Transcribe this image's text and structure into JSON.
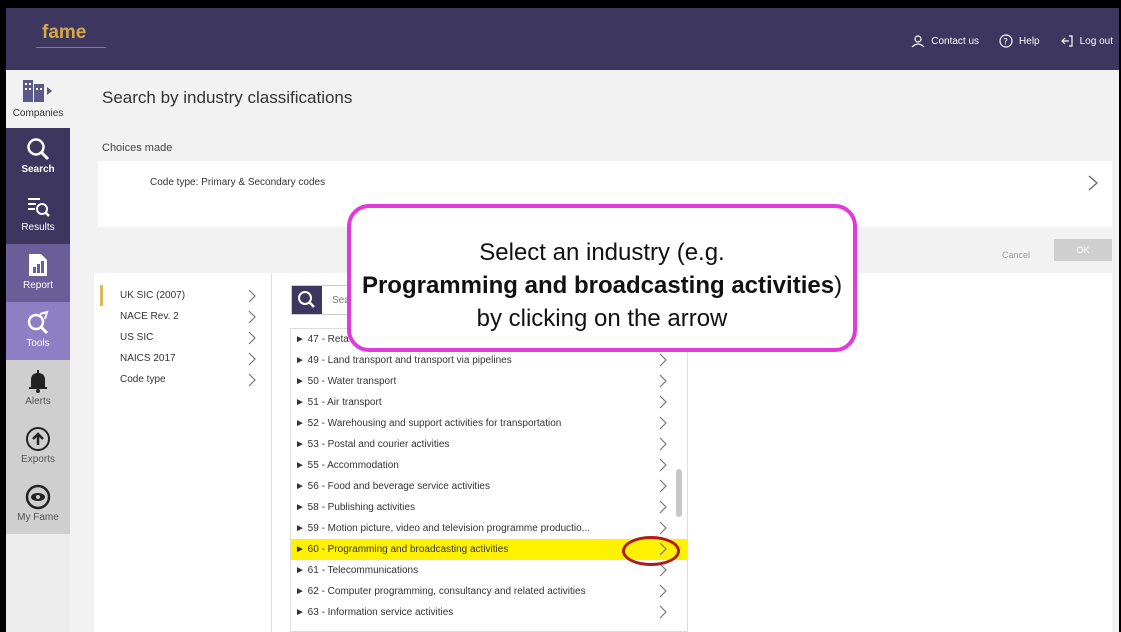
{
  "app": {
    "logo": "fame"
  },
  "topbar": {
    "contact": "Contact us",
    "help": "Help",
    "logout": "Log out"
  },
  "nav": {
    "companies": "Companies",
    "search": "Search",
    "results": "Results",
    "report": "Report",
    "tools": "Tools",
    "alerts": "Alerts",
    "exports": "Exports",
    "myfame": "My Fame"
  },
  "page": {
    "title": "Search by industry classifications",
    "choices_label": "Choices made",
    "code_type": "Code type: Primary & Secondary codes",
    "cancel": "Cancel",
    "ok": "OK"
  },
  "classifications": [
    {
      "label": "UK SIC (2007)",
      "active": true
    },
    {
      "label": "NACE Rev. 2",
      "active": false
    },
    {
      "label": "US SIC",
      "active": false
    },
    {
      "label": "NAICS 2017",
      "active": false
    },
    {
      "label": "Code type",
      "active": false
    }
  ],
  "search": {
    "placeholder": "Sea"
  },
  "industries": [
    {
      "label": "► 47 - Reta",
      "highlight": false
    },
    {
      "label": "► 49 - Land transport and transport via pipelines",
      "highlight": false
    },
    {
      "label": "► 50 - Water transport",
      "highlight": false
    },
    {
      "label": "► 51 - Air transport",
      "highlight": false
    },
    {
      "label": "► 52 - Warehousing and support activities for transportation",
      "highlight": false
    },
    {
      "label": "► 53 - Postal and courier activities",
      "highlight": false
    },
    {
      "label": "► 55 - Accommodation",
      "highlight": false
    },
    {
      "label": "► 56 - Food and beverage service activities",
      "highlight": false
    },
    {
      "label": "► 58 - Publishing activities",
      "highlight": false
    },
    {
      "label": "► 59 - Motion picture, video and television programme productio...",
      "highlight": false
    },
    {
      "label": "► 60 - Programming and broadcasting activities",
      "highlight": true
    },
    {
      "label": "► 61 - Telecommunications",
      "highlight": false
    },
    {
      "label": "► 62 - Computer programming, consultancy and related activities",
      "highlight": false
    },
    {
      "label": "► 63 - Information service activities",
      "highlight": false
    }
  ],
  "callout": {
    "line1": "Select an industry (e.g.",
    "bold": "Programming and broadcasting activities",
    "line3": ") by clicking on the arrow"
  },
  "colors": {
    "brand": "#3d3760",
    "logo": "#d8a64a",
    "highlight": "#fff200",
    "callout_border": "#e23ad8",
    "circle": "#b01a1a"
  }
}
